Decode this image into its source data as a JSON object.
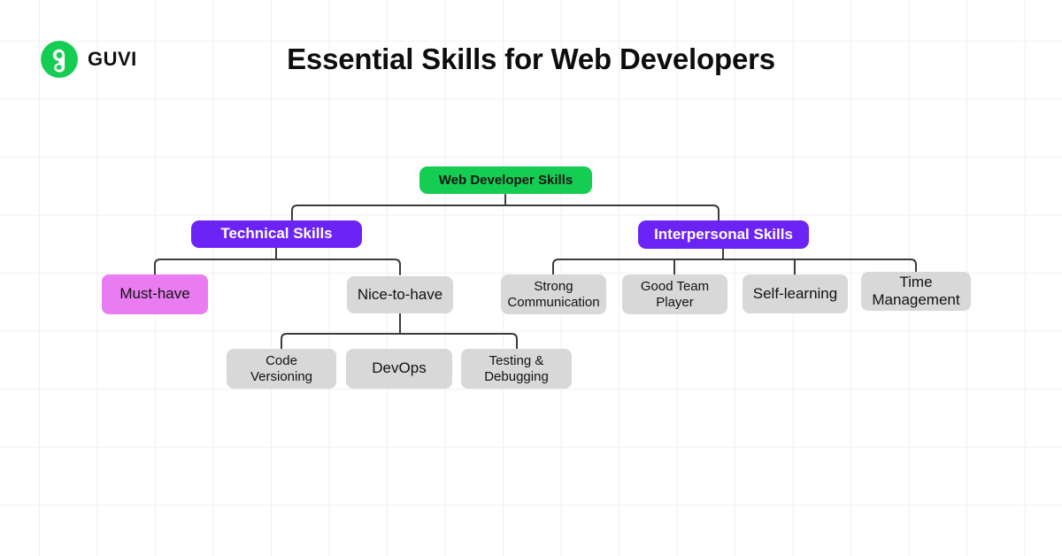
{
  "brand": {
    "logo_icon": "guvi-g-logo-icon",
    "name": "GUVI",
    "logo_color": "#15cd52"
  },
  "header": {
    "title": "Essential Skills for Web Developers"
  },
  "colors": {
    "root": "#15cd52",
    "branch": "#6c24f6",
    "accent": "#e87cf0",
    "plain": "#d8d8d8",
    "connector": "#3b3b3b",
    "grid": "#f1f1f1",
    "text_dark": "#121212",
    "text_light": "#ffffff"
  },
  "diagram": {
    "type": "tree",
    "root": {
      "label": "Web Developer Skills",
      "style": "root"
    },
    "nodes": [
      {
        "id": "technical",
        "label": "Technical Skills",
        "style": "branch"
      },
      {
        "id": "interpersonal",
        "label": "Interpersonal Skills",
        "style": "branch"
      },
      {
        "id": "must_have",
        "label": "Must-have",
        "style": "accent"
      },
      {
        "id": "nice_to_have",
        "label": "Nice-to-have",
        "style": "plain"
      },
      {
        "id": "code_version",
        "label": "Code\nVersioning",
        "style": "plain"
      },
      {
        "id": "devops",
        "label": "DevOps",
        "style": "plain"
      },
      {
        "id": "testing",
        "label": "Testing &\nDebugging",
        "style": "plain"
      },
      {
        "id": "communication",
        "label": "Strong\nCommunication",
        "style": "plain"
      },
      {
        "id": "team_player",
        "label": "Good Team\nPlayer",
        "style": "plain"
      },
      {
        "id": "self_learning",
        "label": "Self-learning",
        "style": "plain"
      },
      {
        "id": "time_mgmt",
        "label": "Time\nManagement",
        "style": "plain"
      }
    ]
  }
}
